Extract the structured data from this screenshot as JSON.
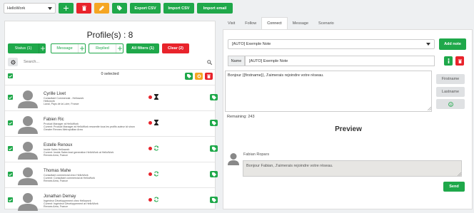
{
  "topbar": {
    "workspace": "HelloWork",
    "export_csv": "Export CSV",
    "import_csv": "Import CSV",
    "import_email": "Import email"
  },
  "profiles": {
    "title": "Profile(s) : 8",
    "filters": {
      "status": "Status (1)",
      "message": "Message",
      "replied": "Replied",
      "all_filters": "All filters (1)",
      "clear": "Clear (2)"
    },
    "search_placeholder": "Search...",
    "selected": "0 selected",
    "items": [
      {
        "name": "Cyrille Livet",
        "info": [
          "Consultant Commercial - Hellowork",
          "Hellowork",
          "Laval, Pays de la Loire, France"
        ],
        "status": "pending"
      },
      {
        "name": "Fabien Ric",
        "info": [
          "Product Manager at HelloWork",
          "Current: Product Manager at HelloWork ressentie tous les profils auteur ici sinon",
          "Greater Rennes Metropolitan Area"
        ],
        "status": "pending"
      },
      {
        "name": "Estelle Renoux",
        "info": [
          "Inside Sales Hellowork",
          "Current: Inside Sales lead generation HelloWork at HelloWork",
          "Rennes Area, France"
        ],
        "status": "sync"
      },
      {
        "name": "Thomas Mahe",
        "info": [
          "Consultant commercial chez HelloWork",
          "Current: Consultant commercial at HelloWork",
          "Rennes Area, France"
        ],
        "status": "sync"
      },
      {
        "name": "Jonathan Demay",
        "info": [
          "Ingénieur Développement chez Hellowork",
          "Current: Ingénieur Développement at HelloWork",
          "Rennes Area, France"
        ],
        "status": "sync"
      }
    ]
  },
  "tabs": [
    "Visit",
    "Follow",
    "Connect",
    "Message",
    "Scenario"
  ],
  "active_tab": "Connect",
  "connect": {
    "template": "[AUTO] Exemple Note",
    "add_note": "Add note",
    "name_label": "Name",
    "name_value": "[AUTO] Exemple Note",
    "message": "Bonjour {{firstname}}, J'aimerais rejoindre votre réseau.",
    "firstname_btn": "Firstname",
    "lastname_btn": "Lastname",
    "remaining": "Remaining: 243",
    "preview_title": "Preview",
    "preview_name": "Fabian Ropars",
    "preview_text": "Bonjour Fabian, J'aimerais rejoindre votre réseau.",
    "send": "Send"
  },
  "colors": {
    "green": "#1fa84a",
    "red": "#e8232b",
    "orange": "#f5a623"
  }
}
